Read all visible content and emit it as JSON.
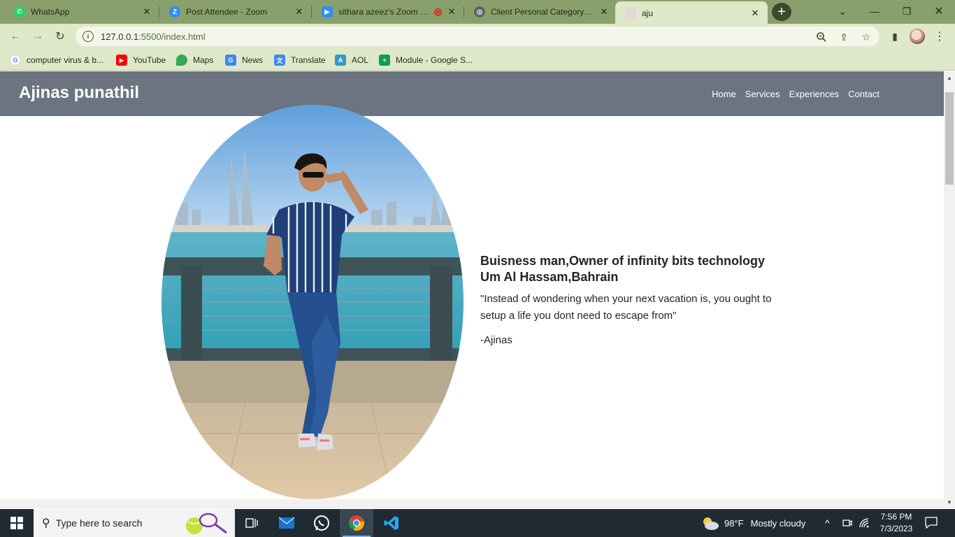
{
  "browser": {
    "tabs": [
      {
        "title": "WhatsApp",
        "icon": "whatsapp-icon",
        "color": "#25d366",
        "active": false
      },
      {
        "title": "Post Attendee - Zoom",
        "icon": "zoom-icon",
        "color": "#2d8cff",
        "active": false
      },
      {
        "title": "sithara azeez's Zoom Me",
        "icon": "zoom-video-icon",
        "color": "#2d8cff",
        "active": false
      },
      {
        "title": "Client Personal Category Flat",
        "icon": "globe-icon",
        "color": "#5f6368",
        "active": false
      },
      {
        "title": "aju",
        "icon": "page-thumbnail-icon",
        "color": "#d8c4c4",
        "active": true
      }
    ],
    "url_host": "127.0.0.1",
    "url_path": ":5500/index.html",
    "bookmarks": [
      {
        "label": "computer virus & b...",
        "icon": "google-icon"
      },
      {
        "label": "YouTube",
        "icon": "youtube-icon"
      },
      {
        "label": "Maps",
        "icon": "maps-icon"
      },
      {
        "label": "News",
        "icon": "news-icon"
      },
      {
        "label": "Translate",
        "icon": "translate-icon"
      },
      {
        "label": "AOL",
        "icon": "aol-icon"
      },
      {
        "label": "Module - Google S...",
        "icon": "sheets-icon"
      }
    ]
  },
  "site": {
    "brand": "Ajinas punathil",
    "nav": [
      "Home",
      "Services",
      "Experiences",
      "Contact"
    ],
    "headline_line1": "Buisness man,Owner of infinity bits technology",
    "headline_line2": "Um Al Hassam,Bahrain",
    "quote": "\"Instead of wondering when your next vacation is, you ought to setup a life you dont need to escape from\"",
    "signature": "-Ajinas",
    "nav_bg": "#6b7480"
  },
  "taskbar": {
    "search_placeholder": "Type here to search",
    "weather_temp": "98°F",
    "weather_desc": "Mostly cloudy",
    "time": "7:56 PM",
    "date": "7/3/2023"
  }
}
